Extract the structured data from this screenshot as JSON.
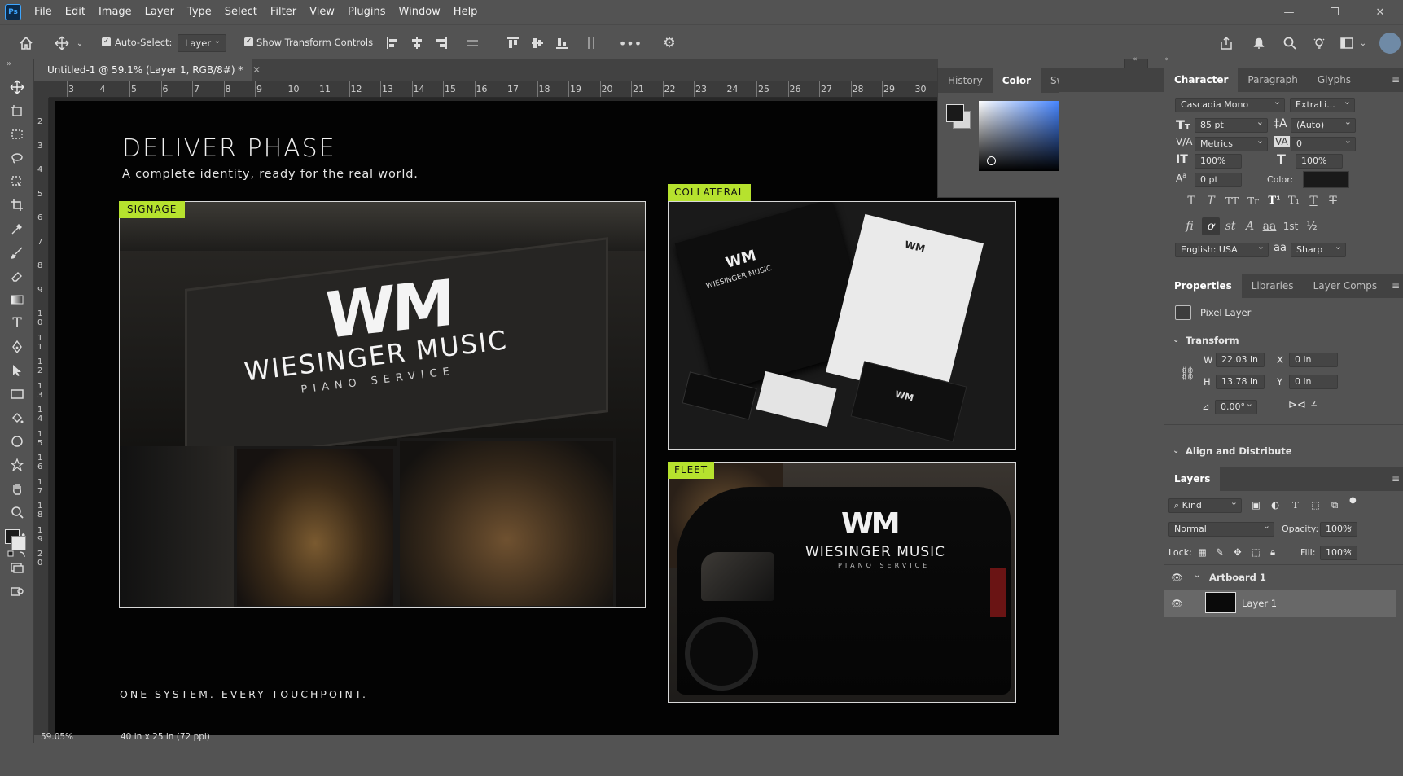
{
  "app": {
    "logo": "Ps"
  },
  "menubar": {
    "items": [
      "File",
      "Edit",
      "Image",
      "Layer",
      "Type",
      "Select",
      "Filter",
      "View",
      "Plugins",
      "Window",
      "Help"
    ]
  },
  "options": {
    "auto_select_label": "Auto-Select:",
    "auto_select_value": "Layer",
    "show_transform_label": "Show Transform Controls",
    "more_icon": "more-icon"
  },
  "document": {
    "tab_title": "Untitled-1 @ 59.1% (Layer 1, RGB/8#) *",
    "ruler_top": [
      "3",
      "4",
      "5",
      "6",
      "7",
      "8",
      "9",
      "10",
      "11",
      "12",
      "13",
      "14",
      "15",
      "16",
      "17",
      "18",
      "19",
      "20",
      "21",
      "22",
      "23",
      "24",
      "25",
      "26",
      "27",
      "28",
      "29",
      "30"
    ],
    "ruler_left": [
      "2",
      "3",
      "4",
      "5",
      "6",
      "7",
      "8",
      "9",
      "1\n0",
      "1\n1",
      "1\n2",
      "1\n3",
      "1\n4",
      "1\n5",
      "1\n6",
      "1\n7",
      "1\n8",
      "1\n9",
      "2\n0"
    ]
  },
  "status": {
    "zoom": "59.05%",
    "doc_size": "40 in x 25 in (72 ppi)"
  },
  "artboard": {
    "title": "DELIVER PHASE",
    "subtitle": "A complete identity, ready for the real world.",
    "footer": "ONE SYSTEM. EVERY TOUCHPOINT.",
    "accent": "#b6e22e",
    "tiles": {
      "signage": {
        "tag": "SIGNAGE",
        "sign_logo": "WM",
        "sign_name": "WIESINGER MUSIC",
        "sign_tag": "PIANO SERVICE"
      },
      "collateral": {
        "tag": "COLLATERAL",
        "logo": "WM",
        "name": "WIESINGER MUSIC",
        "tagline": "PIANO SERVICE"
      },
      "fleet": {
        "tag": "FLEET",
        "logo": "WM",
        "name": "WIESINGER MUSIC",
        "tagline": "PIANO SERVICE"
      }
    }
  },
  "color_panel": {
    "tabs": [
      "History",
      "Color",
      "Swatches"
    ],
    "active": "Color"
  },
  "character": {
    "tabs": [
      "Character",
      "Paragraph",
      "Glyphs"
    ],
    "font_family": "Cascadia Mono",
    "font_style": "ExtraLi...",
    "size": "85 pt",
    "leading": "(Auto)",
    "kerning": "Metrics",
    "tracking": "0",
    "vscale": "100%",
    "hscale": "100%",
    "baseline": "0 pt",
    "color_label": "Color:",
    "style_buttons": [
      "T",
      "T",
      "TT",
      "Tr",
      "T¹",
      "T₁",
      "T",
      "T"
    ],
    "opentype_buttons": [
      "fi",
      "ơ",
      "st",
      "A",
      "aa",
      "1st",
      "½"
    ],
    "language": "English: USA",
    "aa_icon": "aa",
    "antialias": "Sharp"
  },
  "properties": {
    "tabs": [
      "Properties",
      "Libraries",
      "Layer Comps"
    ],
    "kind": "Pixel Layer",
    "transform_label": "Transform",
    "w_label": "W",
    "w_value": "22.03 in",
    "h_label": "H",
    "h_value": "13.78 in",
    "x_label": "X",
    "x_value": "0 in",
    "y_label": "Y",
    "y_value": "0 in",
    "angle": "0.00°",
    "align_label": "Align and Distribute"
  },
  "layers": {
    "tab": "Layers",
    "filter": "Kind",
    "blend": "Normal",
    "opacity_label": "Opacity:",
    "opacity": "100%",
    "lock_label": "Lock:",
    "fill_label": "Fill:",
    "fill": "100%",
    "items": [
      {
        "name": "Artboard 1"
      },
      {
        "name": "Layer 1"
      }
    ]
  }
}
